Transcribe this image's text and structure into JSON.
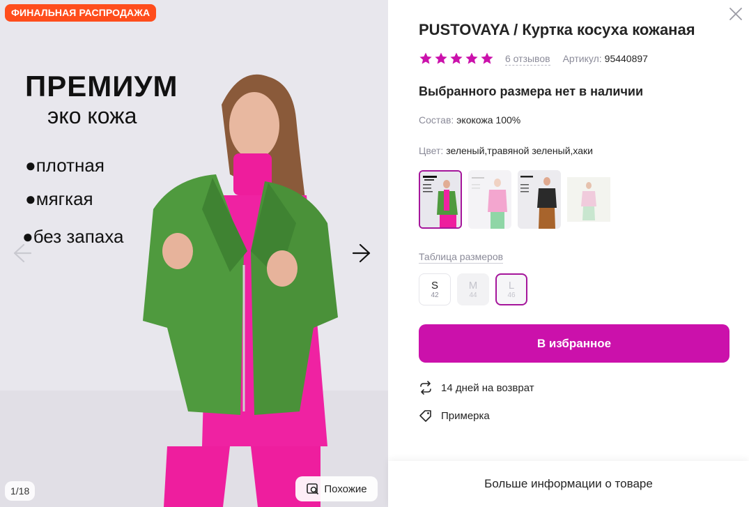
{
  "gallery": {
    "badge": "ФИНАЛЬНАЯ РАСПРОДАЖА",
    "promo_title": "ПРЕМИУМ",
    "promo_subtitle": "эко кожа",
    "promo_points": [
      "●плотная",
      "●мягкая",
      "●без запаха"
    ],
    "counter": "1/18",
    "similar_label": "Похожие",
    "icons": {
      "prev": "arrow-left-icon",
      "next": "arrow-right-icon",
      "similar": "image-search-icon"
    }
  },
  "product": {
    "title": "PUSTOVAYA / Куртка косуха кожаная",
    "rating_stars": 5,
    "reviews": "6 отзывов",
    "article_label": "Артикул:",
    "article_value": "95440897",
    "stock_message": "Выбранного размера нет в наличии",
    "composition_label": "Состав:",
    "composition_value": "экокожа 100%",
    "color_label": "Цвет:",
    "color_value": "зеленый,травяной зеленый,хаки",
    "size_table_label": "Таблица размеров",
    "sizes": [
      {
        "label": "S",
        "num": "42",
        "state": "available"
      },
      {
        "label": "M",
        "num": "44",
        "state": "unavailable"
      },
      {
        "label": "L",
        "num": "46",
        "state": "selected"
      }
    ],
    "favorite_button": "В избранное",
    "return_info": "14 дней на возврат",
    "fitting_info": "Примерка",
    "more_info": "Больше информации о товаре"
  },
  "colors": {
    "accent": "#cb11ab",
    "star": "#cb11ab",
    "badge": "#ff4d1c",
    "selected_border": "#a5159b"
  }
}
